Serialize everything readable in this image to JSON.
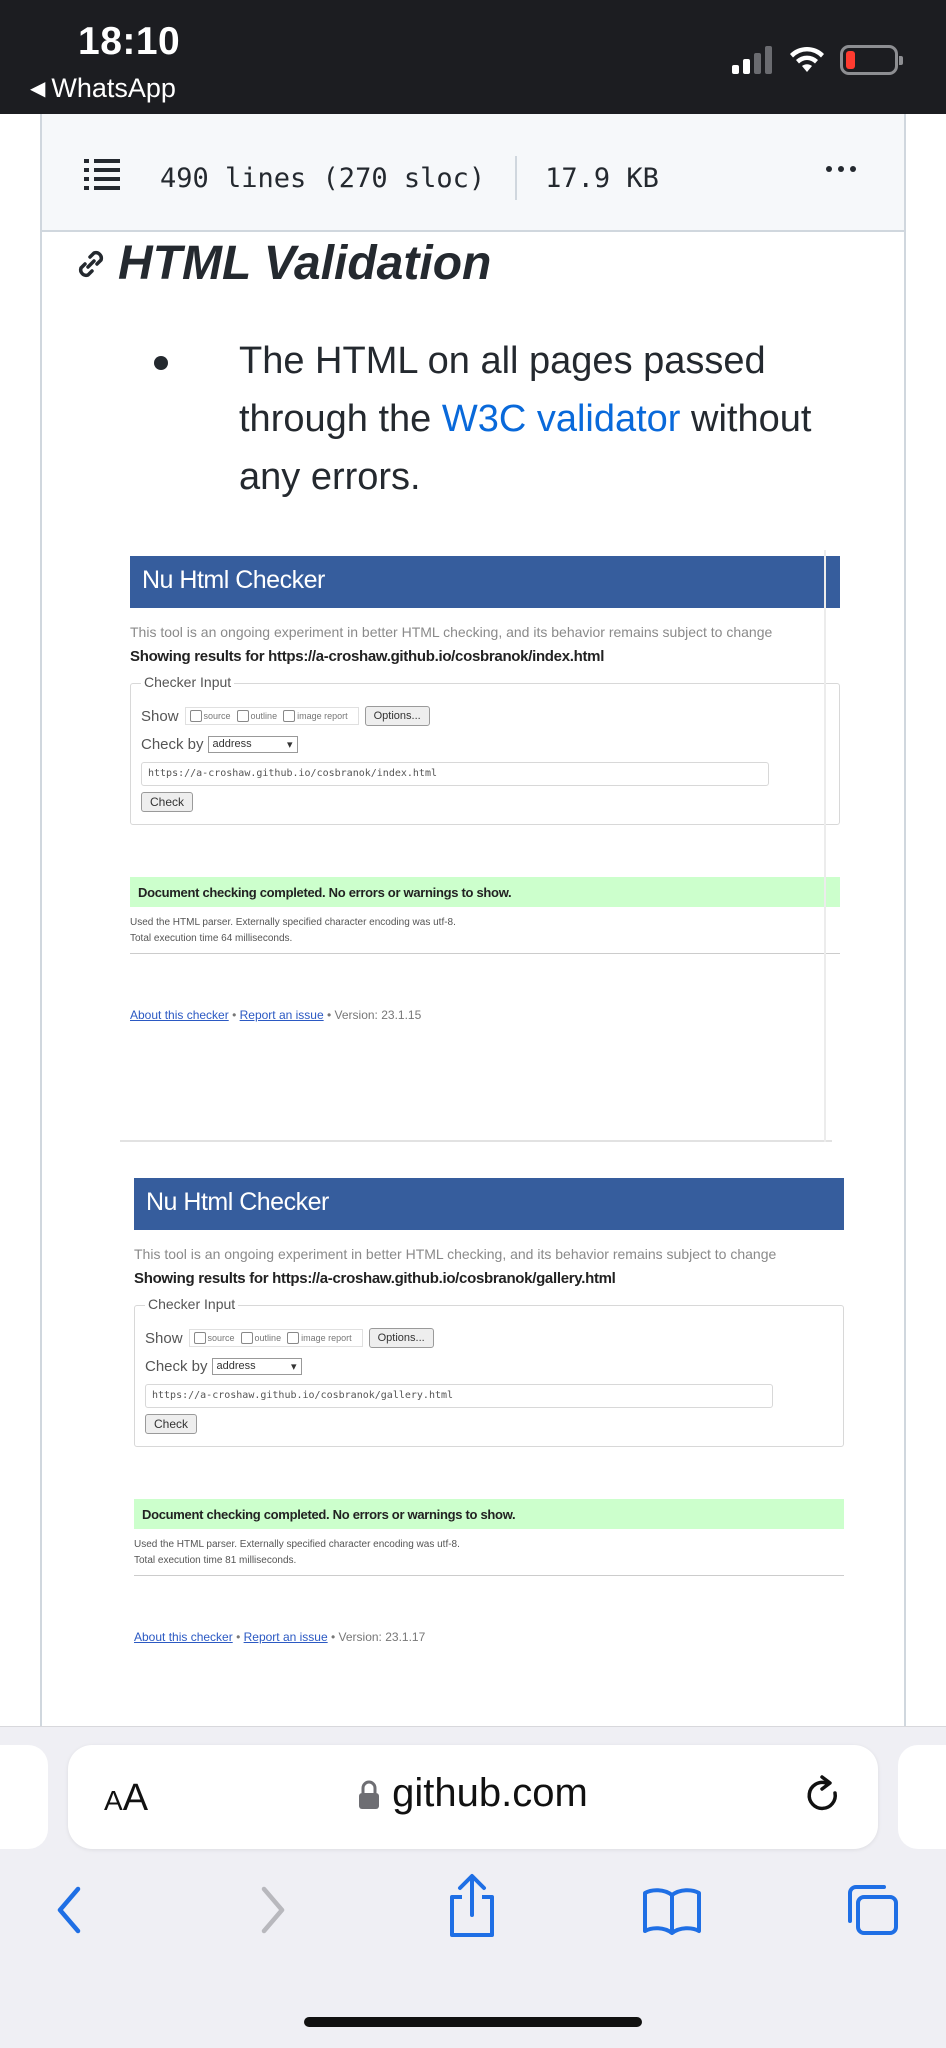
{
  "status": {
    "time": "18:10",
    "back_app": "WhatsApp"
  },
  "file_header": {
    "lines": "490 lines (270 sloc)",
    "size": "17.9 KB"
  },
  "section": {
    "title": "HTML Validation",
    "bullet_before": "The HTML on all pages passed through the ",
    "bullet_link": "W3C validator",
    "bullet_after": " without any errors."
  },
  "checkers": [
    {
      "header": "Nu Html Checker",
      "desc": "This tool is an ongoing experiment in better HTML checking, and its behavior remains subject to change",
      "showing": "Showing results for https://a-croshaw.github.io/cosbranok/index.html",
      "legend": "Checker Input",
      "show_label": "Show",
      "cb_source": "source",
      "cb_outline": "outline",
      "cb_image": "image report",
      "options": "Options...",
      "check_by": "Check by",
      "select": "address",
      "url": "https://a-croshaw.github.io/cosbranok/index.html",
      "check": "Check",
      "success": "Document checking completed. No errors or warnings to show.",
      "info1": "Used the HTML parser. Externally specified character encoding was utf-8.",
      "info2": "Total execution time 64 milliseconds.",
      "about": "About this checker",
      "report": "Report an issue",
      "version": " • Version: 23.1.15"
    },
    {
      "header": "Nu Html Checker",
      "desc": "This tool is an ongoing experiment in better HTML checking, and its behavior remains subject to change",
      "showing": "Showing results for https://a-croshaw.github.io/cosbranok/gallery.html",
      "legend": "Checker Input",
      "show_label": "Show",
      "cb_source": "source",
      "cb_outline": "outline",
      "cb_image": "image report",
      "options": "Options...",
      "check_by": "Check by",
      "select": "address",
      "url": "https://a-croshaw.github.io/cosbranok/gallery.html",
      "check": "Check",
      "success": "Document checking completed. No errors or warnings to show.",
      "info1": "Used the HTML parser. Externally specified character encoding was utf-8.",
      "info2": "Total execution time 81 milliseconds.",
      "about": "About this checker",
      "report": "Report an issue",
      "version": " • Version: 23.1.17"
    }
  ],
  "browser": {
    "aa_small": "A",
    "aa_large": "A",
    "domain": "github.com"
  }
}
